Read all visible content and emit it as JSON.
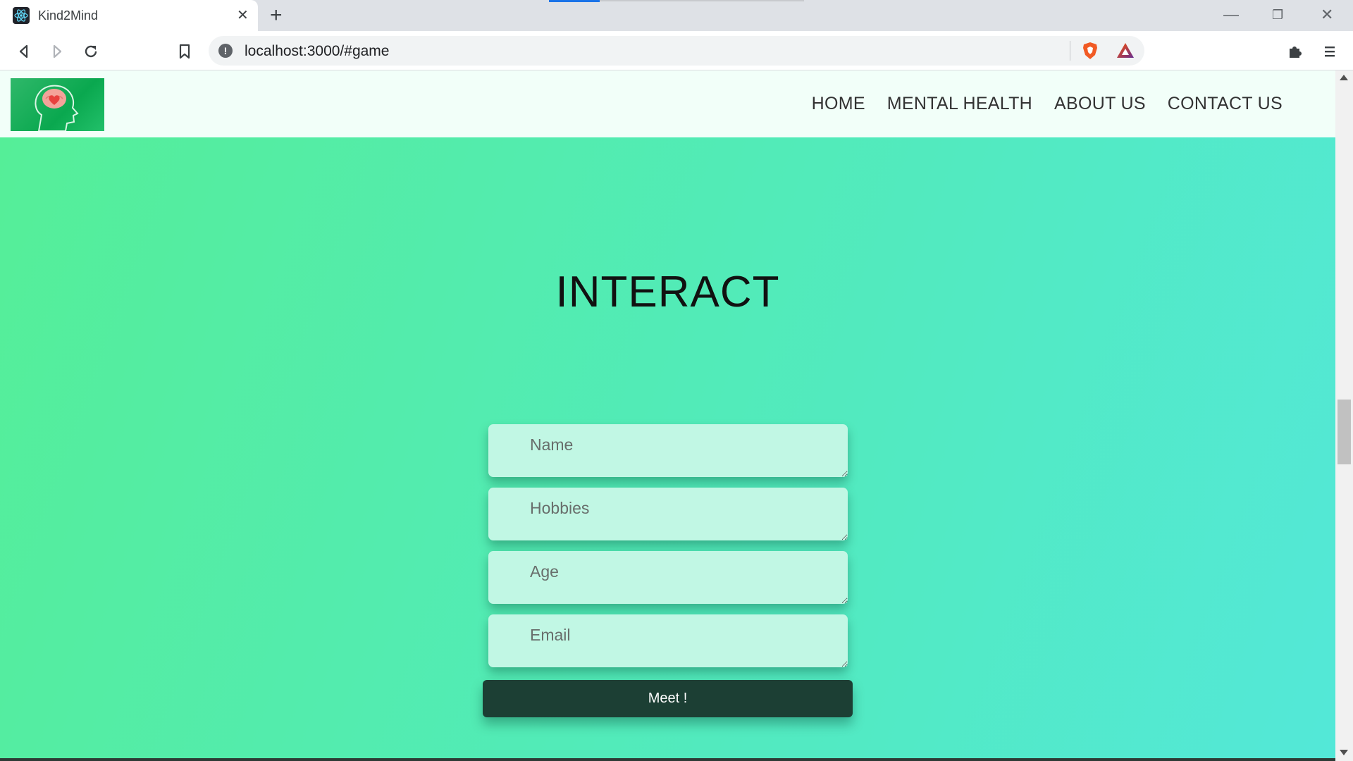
{
  "browser": {
    "tab_title": "Kind2Mind",
    "tab_close": "✕",
    "new_tab": "+",
    "url": "localhost:3000/#game",
    "window": {
      "minimize": "—",
      "restore": "❐",
      "close": "✕"
    },
    "icons": [
      "back-icon",
      "forward-icon",
      "reload-icon",
      "bookmark-icon",
      "info-icon",
      "brave-shield-icon",
      "brave-rewards-icon",
      "extensions-icon",
      "menu-icon"
    ]
  },
  "navbar": {
    "logo_icon": "brain-heart-head-icon",
    "links": [
      "HOME",
      "MENTAL HEALTH",
      "ABOUT US",
      "CONTACT US"
    ]
  },
  "main": {
    "title": "INTERACT",
    "fields": [
      {
        "placeholder": "Name"
      },
      {
        "placeholder": "Hobbies"
      },
      {
        "placeholder": "Age"
      },
      {
        "placeholder": "Email"
      }
    ],
    "submit_label": "Meet !"
  },
  "colors": {
    "hero_gradient_start": "#55ee98",
    "hero_gradient_end": "#53e8d8",
    "field_bg": "#c1f7e4",
    "button_bg": "#1c3f34",
    "navbar_bg": "#f2fff9"
  }
}
